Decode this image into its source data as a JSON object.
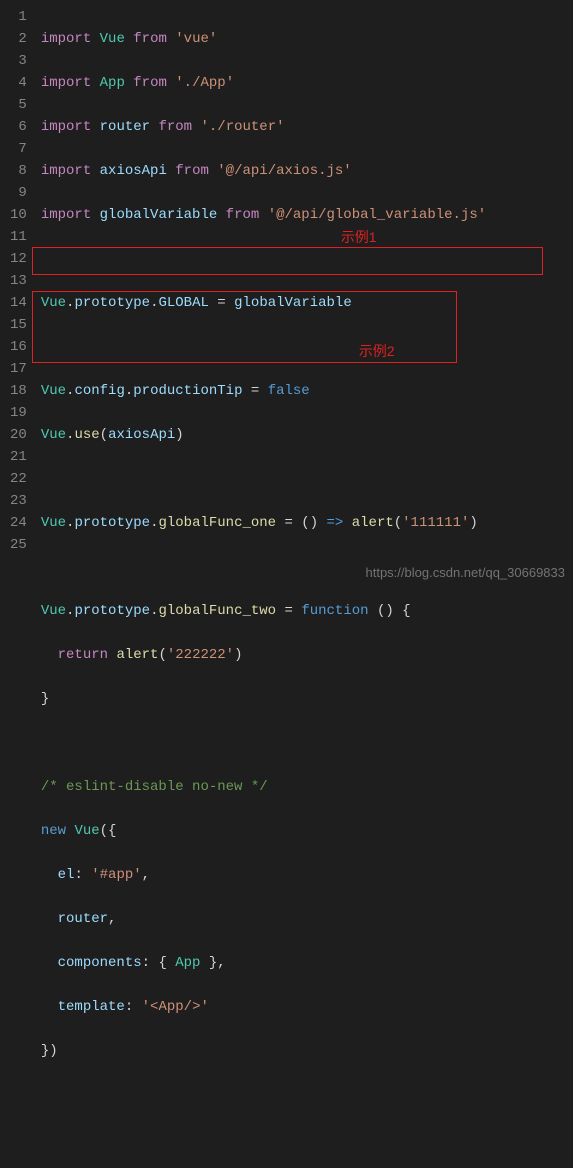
{
  "lineNumbers": [
    "1",
    "2",
    "3",
    "4",
    "5",
    "6",
    "7",
    "8",
    "9",
    "10",
    "11",
    "12",
    "13",
    "14",
    "15",
    "16",
    "17",
    "18",
    "19",
    "20",
    "21",
    "22",
    "23",
    "24",
    "25"
  ],
  "tokens": {
    "l1_import": "import",
    "l1_Vue": "Vue",
    "l1_from": "from",
    "l1_str": "'vue'",
    "l2_import": "import",
    "l2_App": "App",
    "l2_from": "from",
    "l2_str": "'./App'",
    "l3_import": "import",
    "l3_router": "router",
    "l3_from": "from",
    "l3_str": "'./router'",
    "l4_import": "import",
    "l4_axiosApi": "axiosApi",
    "l4_from": "from",
    "l4_str": "'@/api/axios.js'",
    "l5_import": "import",
    "l5_gv": "globalVariable",
    "l5_from": "from",
    "l5_str": "'@/api/global_variable.js'",
    "l7_Vue": "Vue",
    "l7_proto": "prototype",
    "l7_GLOBAL": "GLOBAL",
    "l7_gv": "globalVariable",
    "l9_Vue": "Vue",
    "l9_config": "config",
    "l9_pt": "productionTip",
    "l9_false": "false",
    "l10_Vue": "Vue",
    "l10_use": "use",
    "l10_axiosApi": "axiosApi",
    "l12_Vue": "Vue",
    "l12_proto": "prototype",
    "l12_fn": "globalFunc_one",
    "l12_alert": "alert",
    "l12_str": "'111111'",
    "l14_Vue": "Vue",
    "l14_proto": "prototype",
    "l14_fn": "globalFunc_two",
    "l14_function": "function",
    "l15_return": "return",
    "l15_alert": "alert",
    "l15_str": "'222222'",
    "l18_comment": "/* eslint-disable no-new */",
    "l19_new": "new",
    "l19_Vue": "Vue",
    "l20_el": "el",
    "l20_str": "'#app'",
    "l21_router": "router",
    "l22_components": "components",
    "l22_App": "App",
    "l23_template": "template",
    "l23_str": "'<App/>'"
  },
  "annotations": {
    "example1": "示例1",
    "example2": "示例2"
  },
  "watermark": "https://blog.csdn.net/qq_30669833"
}
